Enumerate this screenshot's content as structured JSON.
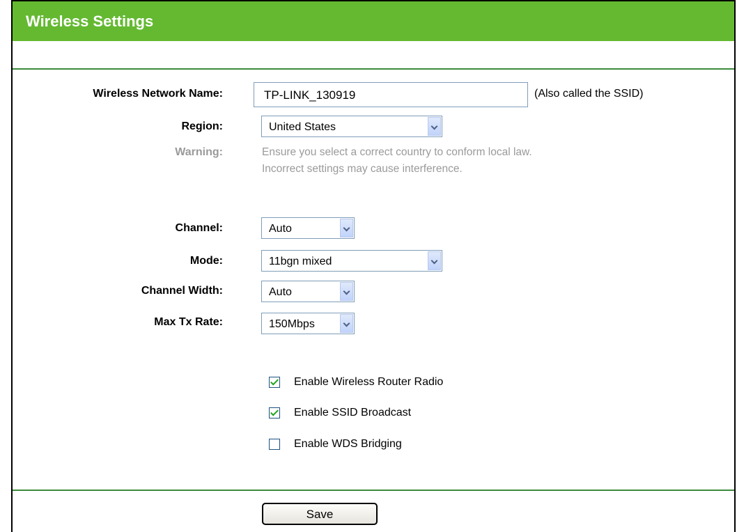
{
  "header": {
    "title": "Wireless Settings"
  },
  "ssid": {
    "label": "Wireless Network Name:",
    "value": "TP-LINK_130919",
    "note": "(Also called the SSID)"
  },
  "region": {
    "label": "Region:",
    "value": "United States"
  },
  "warning": {
    "label": "Warning:",
    "line1": "Ensure you select a correct country to conform local law.",
    "line2": "Incorrect settings may cause interference."
  },
  "channel": {
    "label": "Channel:",
    "value": "Auto"
  },
  "mode": {
    "label": "Mode:",
    "value": "11bgn mixed"
  },
  "channel_width": {
    "label": "Channel Width:",
    "value": "Auto"
  },
  "max_tx_rate": {
    "label": "Max Tx Rate:",
    "value": "150Mbps"
  },
  "options": [
    {
      "label": "Enable Wireless Router Radio",
      "checked": true
    },
    {
      "label": "Enable SSID Broadcast",
      "checked": true
    },
    {
      "label": "Enable WDS Bridging",
      "checked": false
    }
  ],
  "save": {
    "label": "Save"
  },
  "colors": {
    "header_bg": "#64b931",
    "divider": "#3b8a3b",
    "warning_text": "#9a9a9a"
  }
}
